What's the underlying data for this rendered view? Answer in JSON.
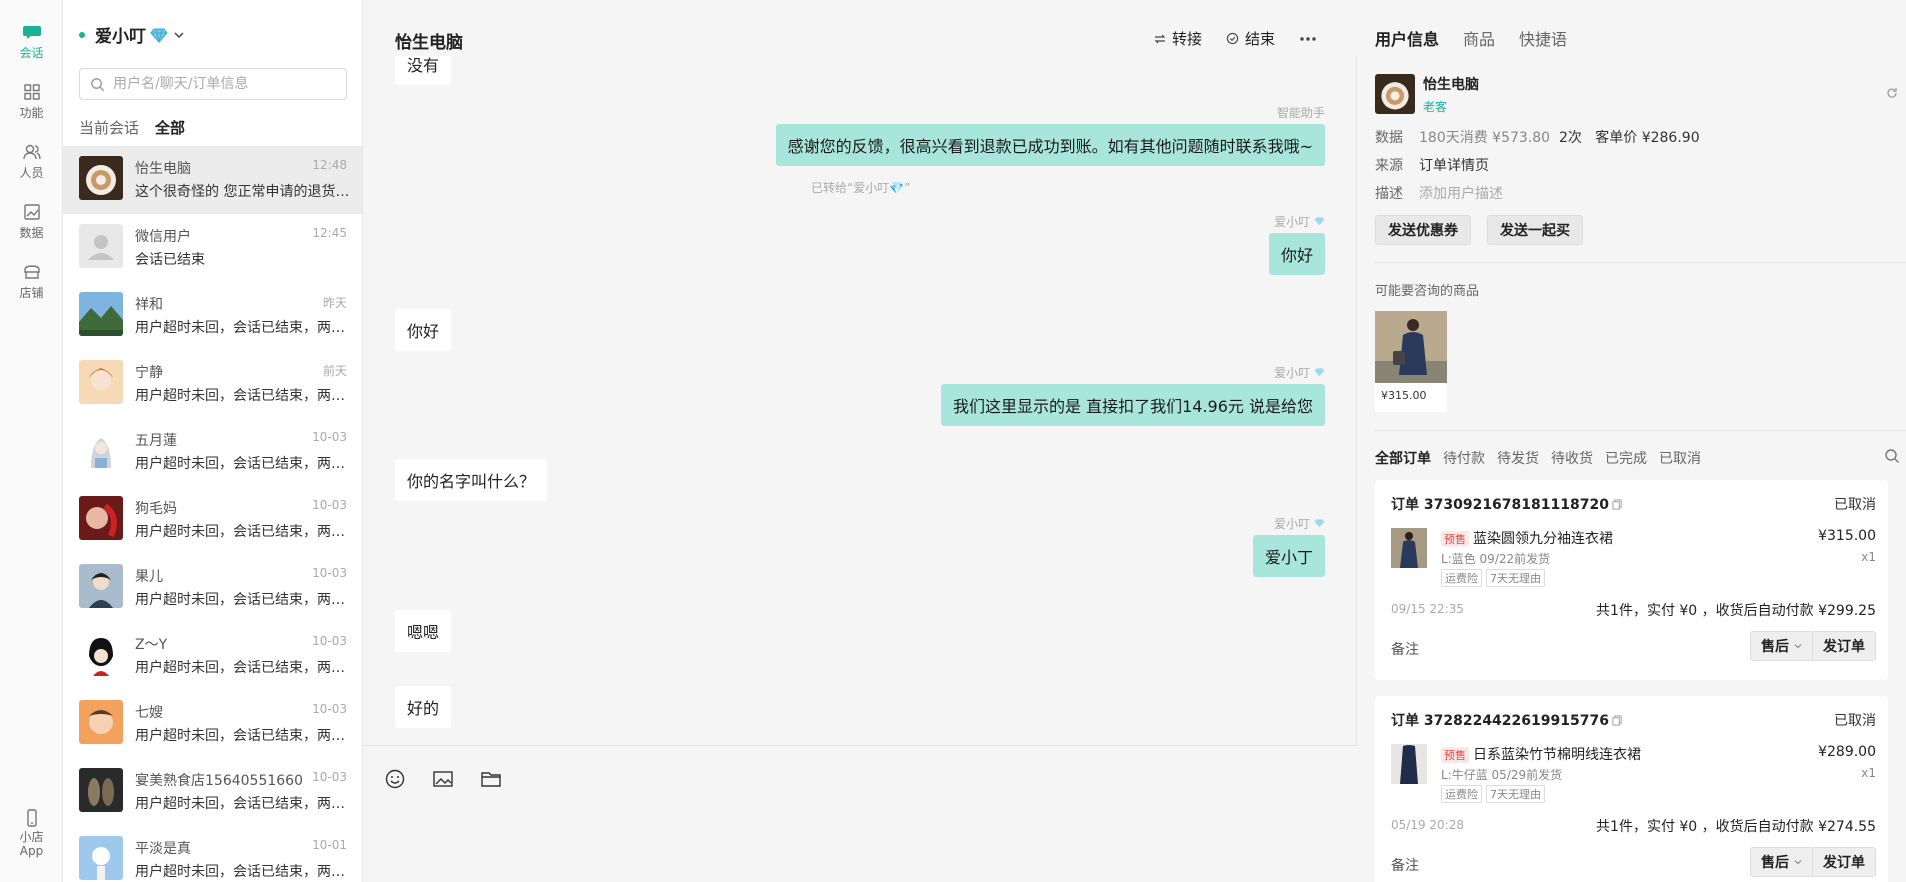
{
  "nav": {
    "items": [
      {
        "label": "会话",
        "icon": "chat-icon"
      },
      {
        "label": "功能",
        "icon": "grid-icon"
      },
      {
        "label": "人员",
        "icon": "people-icon"
      },
      {
        "label": "数据",
        "icon": "data-icon"
      },
      {
        "label": "店铺",
        "icon": "store-icon"
      }
    ],
    "app_label_1": "小店",
    "app_label_2": "App",
    "accent": "#19b394"
  },
  "conversations": {
    "account_name": "爱小叮",
    "search_placeholder": "用户名/聊天/订单信息",
    "tabs": [
      "当前会话",
      "全部"
    ],
    "items": [
      {
        "name": "怡生电脑",
        "time": "12:48",
        "message": "这个很奇怪的 您正常申请的退货…"
      },
      {
        "name": "微信用户",
        "time": "12:45",
        "message": "会话已结束"
      },
      {
        "name": "祥和",
        "time": "昨天",
        "message": "用户超时未回，会话已结束，两…"
      },
      {
        "name": "宁静",
        "time": "前天",
        "message": "用户超时未回，会话已结束，两…"
      },
      {
        "name": "五月蓮",
        "time": "10-03",
        "message": "用户超时未回，会话已结束，两…"
      },
      {
        "name": "狗毛妈",
        "time": "10-03",
        "message": "用户超时未回，会话已结束，两…"
      },
      {
        "name": "果儿",
        "time": "10-03",
        "message": "用户超时未回，会话已结束，两…"
      },
      {
        "name": "Z～Y",
        "time": "10-03",
        "message": "用户超时未回，会话已结束，两…"
      },
      {
        "name": "七嫂",
        "time": "10-03",
        "message": "用户超时未回，会话已结束，两…"
      },
      {
        "name": "宴美熟食店15640551660",
        "time": "10-03",
        "message": "用户超时未回，会话已结束，两…"
      },
      {
        "name": "平淡是真",
        "time": "10-01",
        "message": "用户超时未回，会话已结束，两…"
      }
    ]
  },
  "chat": {
    "title": "怡生电脑",
    "transfer_label": "转接",
    "end_label": "结束",
    "messages": {
      "m0": "没有",
      "assistant_sender": "智能助手",
      "m1": "感谢您的反馈，很高兴看到退款已成功到账。如有其他问题随时联系我哦~",
      "transfer_note": "已转给“爱小叮💎”",
      "agent_sender": "爱小叮",
      "m2": "你好",
      "m3": "你好",
      "m4": "我们这里显示的是 直接扣了我们14.96元 说是给您",
      "m5": "你的名字叫什么？",
      "m6": "爱小丁",
      "m7": "嗯嗯",
      "m8": "好的"
    }
  },
  "panel": {
    "tabs": [
      "用户信息",
      "商品",
      "快捷语"
    ],
    "user": {
      "name": "怡生电脑",
      "tag": "老客",
      "stats_label": "数据",
      "spend": "180天消费 ¥573.80",
      "times": "2次",
      "avg": "客单价 ¥286.90",
      "source_label": "来源",
      "source": "订单详情页",
      "desc_label": "描述",
      "desc_placeholder": "添加用户描述"
    },
    "buttons": {
      "coupon": "发送优惠券",
      "group_buy": "发送一起买"
    },
    "suggest_label": "可能要咨询的商品",
    "suggest_price": "¥315.00",
    "order_tabs": [
      "全部订单",
      "待付款",
      "待发货",
      "待收货",
      "已完成",
      "已取消"
    ],
    "orders": [
      {
        "id": "订单 3730921678181118720",
        "status": "已取消",
        "presale": "预售",
        "title": "蓝染圆领九分袖连衣裙",
        "spec": "L:蓝色 09/22前发货",
        "chips": [
          "运费险",
          "7天无理由"
        ],
        "price": "¥315.00",
        "qty": "x1",
        "date": "09/15 22:35",
        "summary": "共1件，实付 ¥0 ，收货后自动付款 ¥299.25",
        "note": "备注",
        "aftersale": "售后",
        "send": "发订单"
      },
      {
        "id": "订单 3728224422619915776",
        "status": "已取消",
        "presale": "预售",
        "title": "日系蓝染竹节棉明线连衣裙",
        "spec": "L:牛仔蓝 05/29前发货",
        "chips": [
          "运费险",
          "7天无理由"
        ],
        "price": "¥289.00",
        "qty": "x1",
        "date": "05/19 20:28",
        "summary": "共1件，实付 ¥0 ，收货后自动付款 ¥274.55",
        "note": "备注",
        "aftersale": "售后",
        "send": "发订单"
      }
    ]
  }
}
